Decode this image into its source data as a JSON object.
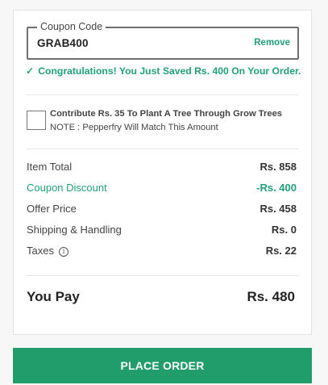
{
  "coupon": {
    "legend": "Coupon Code",
    "value": "GRAB400",
    "remove_label": "Remove",
    "success_message": "Congratulations! You Just Saved Rs. 400 On Your Order."
  },
  "donation": {
    "title": "Contribute Rs. 35 To Plant A Tree Through Grow Trees",
    "note": "NOTE : Pepperfry Will Match This Amount",
    "checked": false
  },
  "summary": {
    "rows": [
      {
        "label": "Item Total",
        "value": "Rs. 858"
      },
      {
        "label": "Coupon Discount",
        "value": "-Rs. 400"
      },
      {
        "label": "Offer Price",
        "value": "Rs. 458"
      },
      {
        "label": "Shipping & Handling",
        "value": "Rs. 0"
      },
      {
        "label": "Taxes",
        "value": "Rs. 22"
      }
    ],
    "total_label": "You Pay",
    "total_value": "Rs. 480"
  },
  "actions": {
    "place_order_label": "PLACE ORDER"
  },
  "icons": {
    "success": "check-icon",
    "taxes_info": "info-icon"
  },
  "colors": {
    "accent": "#21a07a",
    "button": "#219c6b"
  }
}
